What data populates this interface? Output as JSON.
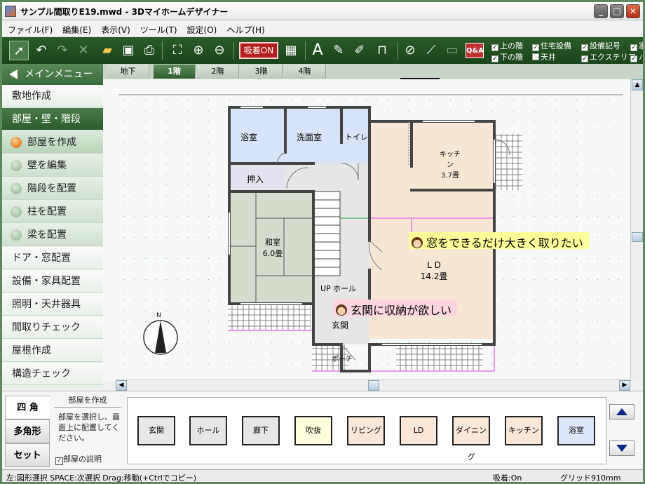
{
  "window": {
    "title": "サンプル間取りE19.mwd - 3Dマイホームデザイナー"
  },
  "menu": [
    "ファイル(F)",
    "編集(E)",
    "表示(V)",
    "ツール(T)",
    "設定(O)",
    "ヘルプ(H)"
  ],
  "toolbar": {
    "suction_label": "吸着ON",
    "qa_label": "Q&A",
    "checks": [
      {
        "label": "上の階",
        "checked": true
      },
      {
        "label": "住宅設備",
        "checked": true
      },
      {
        "label": "設備記号",
        "checked": true
      },
      {
        "label": "家",
        "checked": true
      },
      {
        "label": "下の階",
        "checked": true
      },
      {
        "label": "天井",
        "checked": false
      },
      {
        "label": "エクステリア",
        "checked": true
      },
      {
        "label": "ハ",
        "checked": true
      }
    ]
  },
  "sidebar": {
    "header": "メインメニュー",
    "items": [
      {
        "label": "敷地作成",
        "type": "main"
      },
      {
        "label": "部屋・壁・階段",
        "type": "active"
      },
      {
        "label": "部屋を作成",
        "type": "sub-selected"
      },
      {
        "label": "壁を編集",
        "type": "sub"
      },
      {
        "label": "階段を配置",
        "type": "sub"
      },
      {
        "label": "柱を配置",
        "type": "sub"
      },
      {
        "label": "梁を配置",
        "type": "sub"
      },
      {
        "label": "ドア・窓配置",
        "type": "main"
      },
      {
        "label": "設備・家具配置",
        "type": "main"
      },
      {
        "label": "照明・天井器具",
        "type": "main"
      },
      {
        "label": "間取りチェック",
        "type": "main"
      },
      {
        "label": "屋根作成",
        "type": "main"
      },
      {
        "label": "構造チェック",
        "type": "main"
      }
    ]
  },
  "floor_tabs": [
    {
      "label": "地下",
      "active": false
    },
    {
      "label": "1階",
      "active": true
    },
    {
      "label": "2階",
      "active": false
    },
    {
      "label": "3階",
      "active": false
    },
    {
      "label": "4階",
      "active": false
    }
  ],
  "plan": {
    "rooms": {
      "bath": "浴室",
      "washroom": "洗面室",
      "toilet": "トイレ",
      "closet": "押入",
      "washitsu": "和室",
      "washitsu_size": "6.0畳",
      "kitchen": "キッチン",
      "kitchen_size": "3.7畳",
      "ld": "L D",
      "ld_size": "14.2畳",
      "hall": "UP ホール",
      "entrance": "玄関",
      "porch": "ポーチ"
    },
    "notes": [
      {
        "text": "窓をできるだけ大きく取りたい",
        "color": "#ffff99"
      },
      {
        "text": "玄関に収納が欲しい",
        "color": "#ffd6e0"
      }
    ],
    "compass_label": "N"
  },
  "bottom": {
    "shape_tabs": [
      {
        "label": "四 角",
        "active": true
      },
      {
        "label": "多角形",
        "active": false
      },
      {
        "label": "セット",
        "active": false
      }
    ],
    "desc_title": "部屋を作成",
    "desc_text": "部屋を選択し、画面上に配置してください。",
    "desc_check": "部屋の説明",
    "palette": [
      {
        "label": "玄関",
        "color": "#e8e8e8"
      },
      {
        "label": "ホール",
        "color": "#e6e6e6"
      },
      {
        "label": "廊下",
        "color": "#e6e6e6"
      },
      {
        "label": "吹抜",
        "color": "#ffffdd"
      },
      {
        "label": "リビング",
        "color": "#fbe7d8"
      },
      {
        "label": "LD",
        "color": "#fbe7d8"
      },
      {
        "label": "ダイニング",
        "color": "#fbe7d8"
      },
      {
        "label": "キッチン",
        "color": "#fbe7d8"
      },
      {
        "label": "浴室",
        "color": "#dce6fa"
      }
    ]
  },
  "status": {
    "hint": "左:図形選択 SPACE:次選択 Drag:移動(+Ctrlでコピー)",
    "snap": "吸着:On",
    "grid": "グリッド910mm"
  }
}
